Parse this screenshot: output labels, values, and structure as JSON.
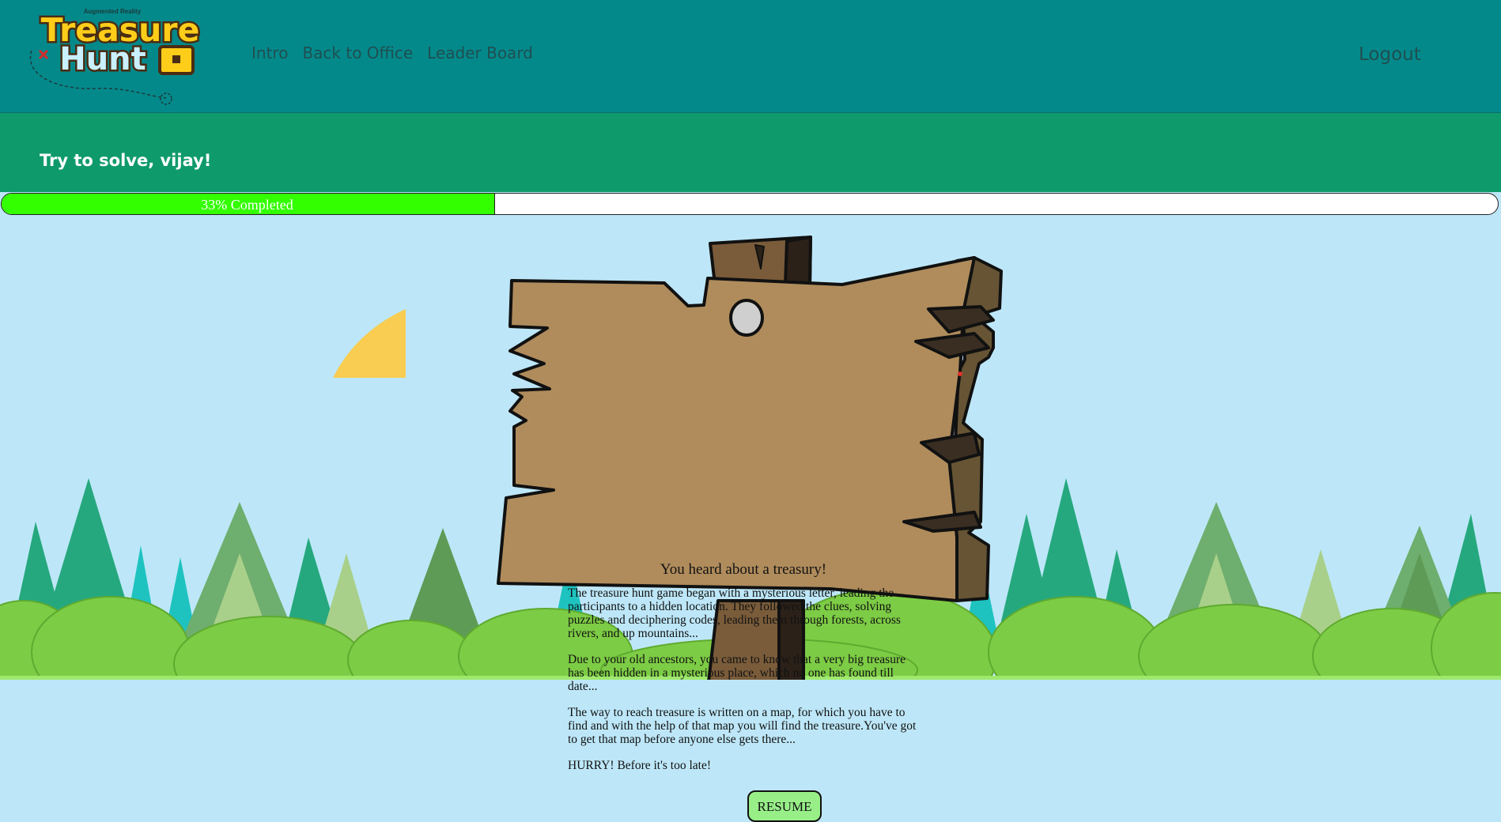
{
  "header": {
    "logo": {
      "tagline": "Augmented Reality",
      "line1": "Treasure",
      "line2": "Hunt"
    },
    "nav": [
      "Intro",
      "Back to Office",
      "Leader Board"
    ],
    "logout_label": "Logout"
  },
  "banner": {
    "greeting": "Try to solve, vijay!"
  },
  "progress": {
    "percent": 33,
    "label": "33% Completed"
  },
  "sign": {
    "title": "You heard about a treasury!",
    "paragraphs": [
      "The treasure hunt game began with a mysterious letter, leading the participants to a hidden location. They followed the clues, solving puzzles and deciphering codes, leading them through forests, across rivers, and up mountains...",
      "Due to your old ancestors, you came to know that a very big treasure has been hidden in a mysterious place, which no one has found till date...",
      "The way to reach treasure is written on a map, for which you have to find and with the help of that map you will find the treasure.You've got to get that map before anyone else gets there...",
      "HURRY! Before it's too late!"
    ],
    "resume_label": "RESUME"
  },
  "colors": {
    "header_bg": "#04898b",
    "banner_bg": "#0f9a6b",
    "progress_fill": "#33ff00",
    "sky": "#bde7f8",
    "wood": "#b08c5c",
    "resume_bg": "#98ef88"
  }
}
